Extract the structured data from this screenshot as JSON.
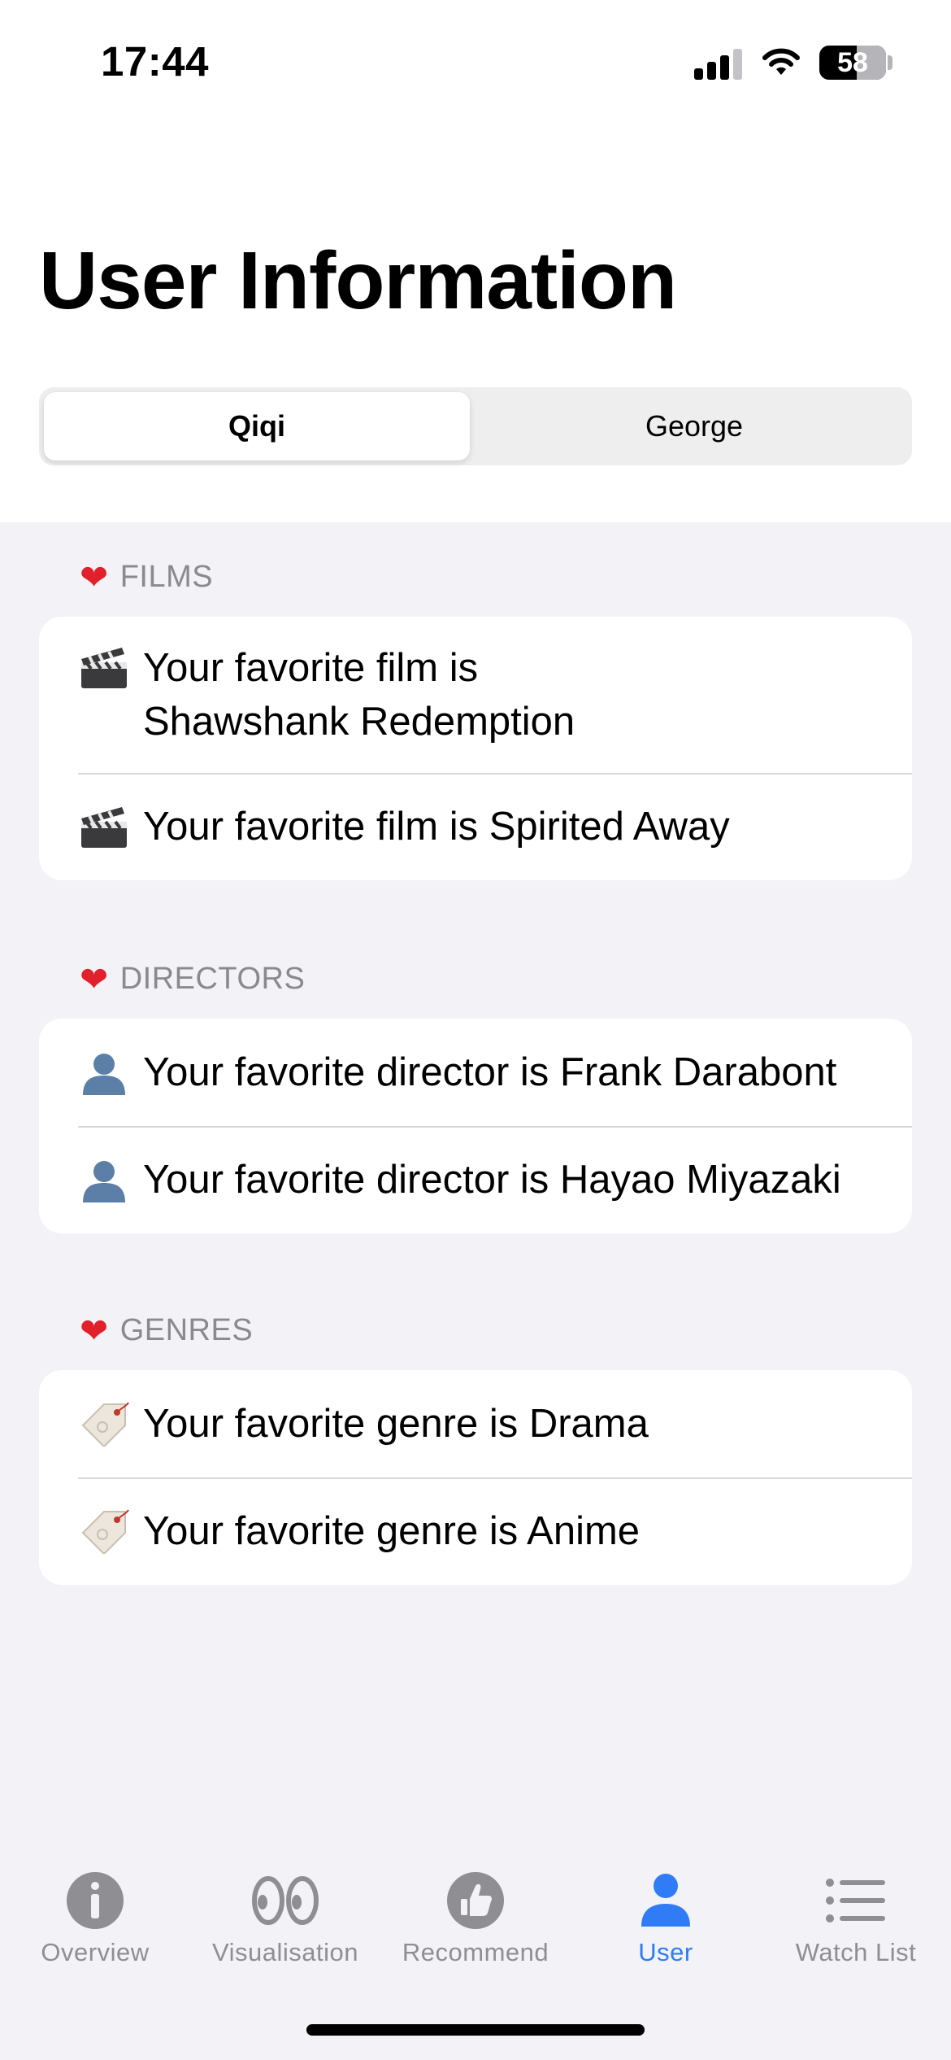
{
  "status_bar": {
    "time": "17:44",
    "battery": "58"
  },
  "header": {
    "title": "User Information"
  },
  "segmented_control": {
    "options": [
      "Qiqi",
      "George"
    ],
    "selected": "Qiqi"
  },
  "sections": {
    "films": {
      "header": "FILMS",
      "rows": [
        {
          "text": "Your favorite film is Shawshank Redemption",
          "icon": "clapper-board-icon"
        },
        {
          "text": "Your favorite film is Spirited Away",
          "icon": "clapper-board-icon"
        }
      ]
    },
    "directors": {
      "header": "DIRECTORS",
      "rows": [
        {
          "text": "Your favorite director is Frank Darabont",
          "icon": "person-silhouette-icon"
        },
        {
          "text": "Your favorite director is Hayao Miyazaki",
          "icon": "person-silhouette-icon"
        }
      ]
    },
    "genres": {
      "header": "GENRES",
      "rows": [
        {
          "text": "Your favorite genre is Drama",
          "icon": "label-tag-icon"
        },
        {
          "text": "Your favorite genre is Anime",
          "icon": "label-tag-icon"
        }
      ]
    }
  },
  "tab_bar": {
    "tabs": [
      {
        "label": "Overview",
        "icon": "info-circle-icon"
      },
      {
        "label": "Visualisation",
        "icon": "eyes-icon"
      },
      {
        "label": "Recommend",
        "icon": "thumbs-up-icon"
      },
      {
        "label": "User",
        "icon": "person-icon"
      },
      {
        "label": "Watch List",
        "icon": "list-icon"
      }
    ],
    "active": "User"
  },
  "colors": {
    "accent": "#2f7cf6",
    "background": "#f2f2f7",
    "inactive_tab": "#8e8e93",
    "section_header": "#8a8a8e",
    "heart": "#e0202a"
  }
}
